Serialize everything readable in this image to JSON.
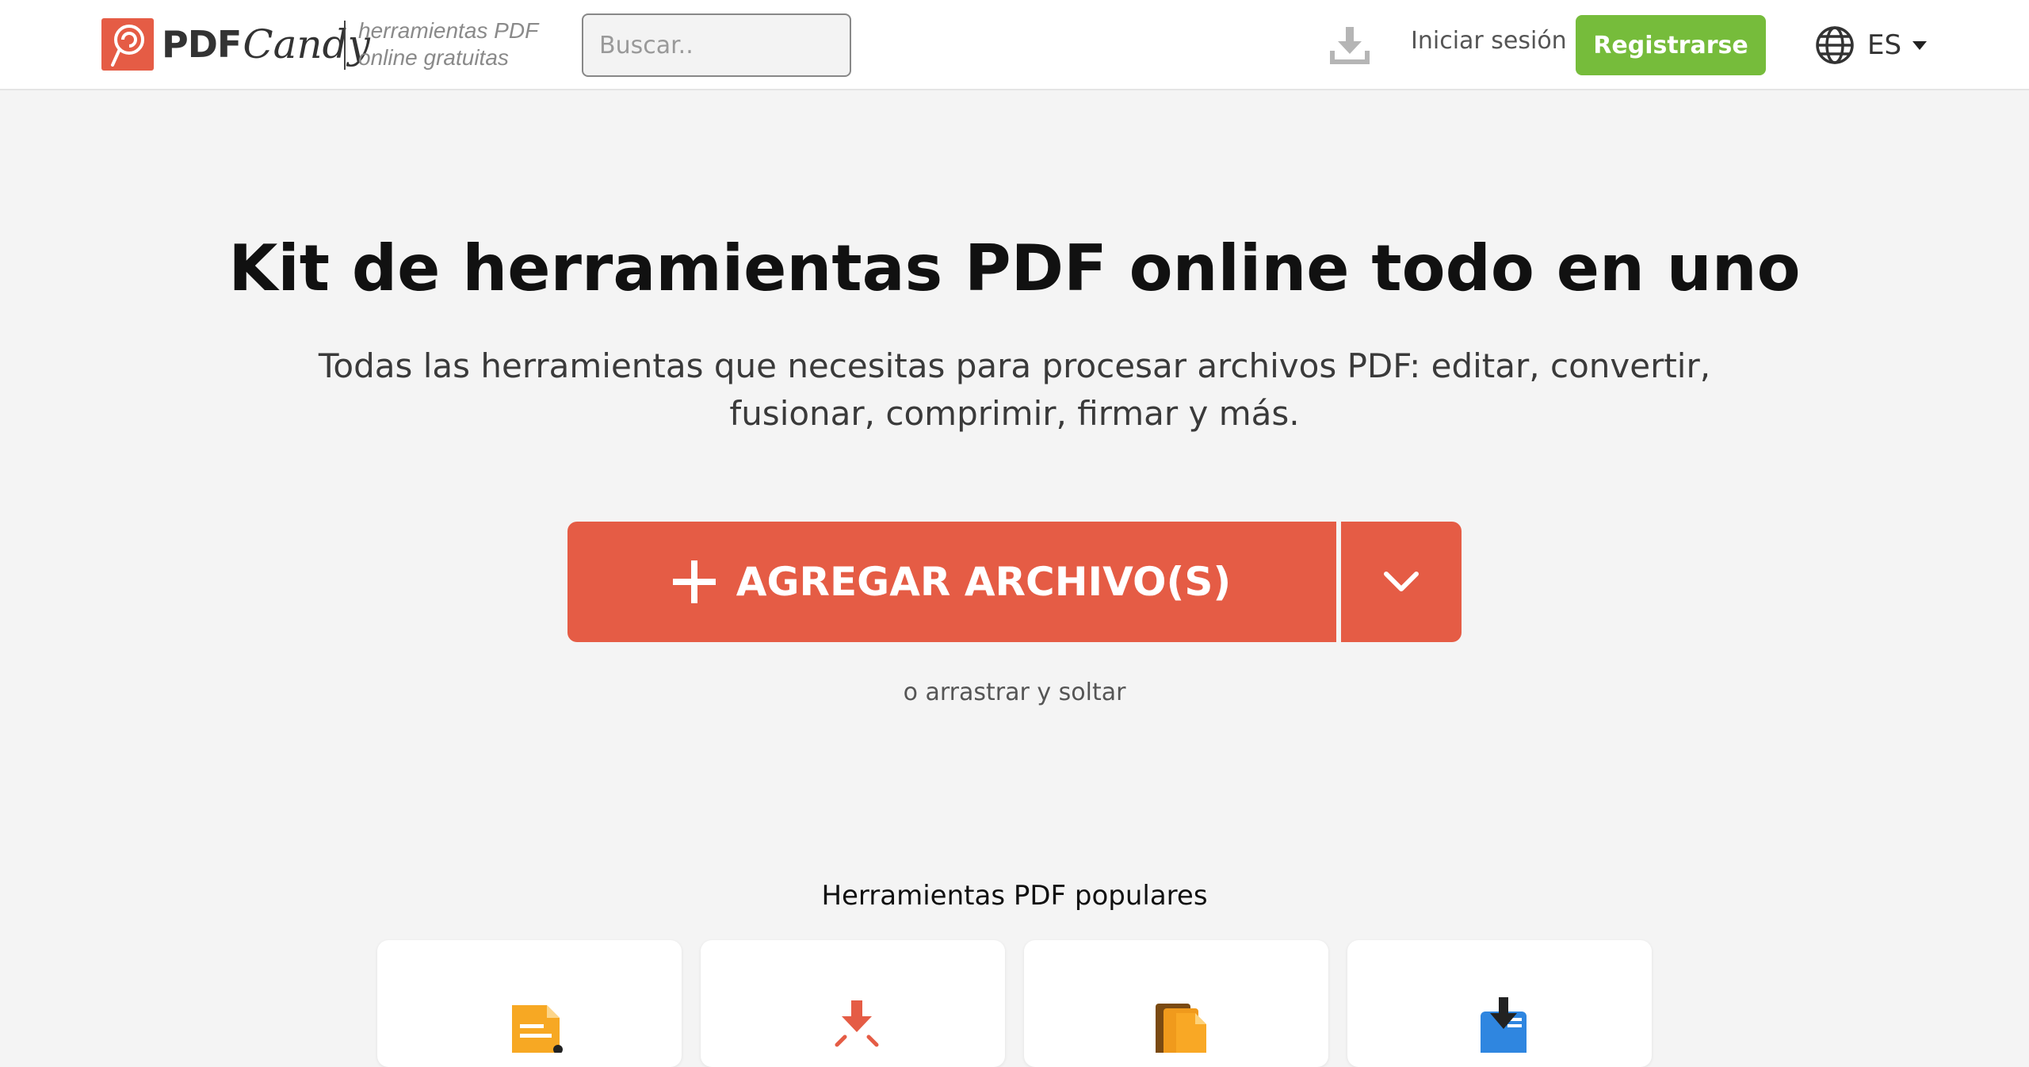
{
  "header": {
    "logo": {
      "pdf": "PDF",
      "candy": "Candy"
    },
    "tagline": [
      "herramientas PDF",
      "online gratuitas"
    ],
    "search": {
      "placeholder": "Buscar..",
      "value": ""
    },
    "download_icon": "download-icon",
    "signin_label": "Iniciar sesión",
    "register_label": "Registrarse",
    "language": {
      "icon": "globe-icon",
      "label": "ES"
    }
  },
  "hero": {
    "title": "Kit de herramientas PDF online todo en uno",
    "subtitle": "Todas las herramientas que necesitas para procesar archivos PDF: editar, convertir, fusionar, comprimir, firmar y más.",
    "add_button_label": "AGREGAR ARCHIVO(S)",
    "drag_hint": "o arrastrar y soltar"
  },
  "popular": {
    "title": "Herramientas PDF populares",
    "cards": [
      {
        "icon": "edit-document-icon"
      },
      {
        "icon": "compress-icon"
      },
      {
        "icon": "merge-icon"
      },
      {
        "icon": "pdf-to-word-icon"
      }
    ]
  },
  "colors": {
    "brand_red": "#e55c45",
    "register_green": "#76bc3b",
    "background": "#f4f4f4"
  }
}
